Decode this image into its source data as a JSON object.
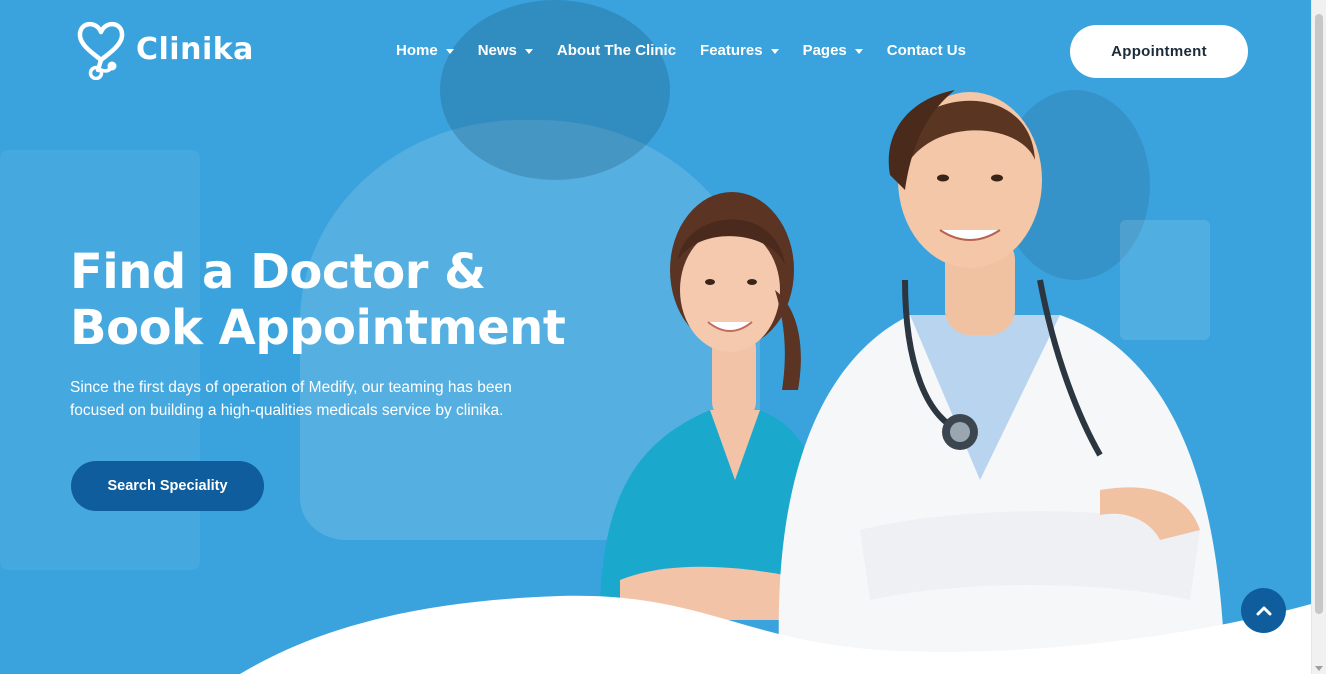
{
  "brand": {
    "name": "Clinika"
  },
  "nav": {
    "items": [
      {
        "label": "Home",
        "has_dropdown": true
      },
      {
        "label": "News",
        "has_dropdown": true
      },
      {
        "label": "About The Clinic",
        "has_dropdown": false
      },
      {
        "label": "Features",
        "has_dropdown": true
      },
      {
        "label": "Pages",
        "has_dropdown": true
      },
      {
        "label": "Contact Us",
        "has_dropdown": false
      }
    ],
    "cta_label": "Appointment"
  },
  "hero": {
    "title_line1": "Find a Doctor &",
    "title_line2": "Book Appointment",
    "description": "Since the first days of operation of Medify, our teaming has been focused on building a high-qualities medicals service by clinika.",
    "button_label": "Search Speciality"
  },
  "icons": {
    "logo": "heart-stethoscope-icon",
    "dropdown": "caret-down-icon",
    "back_to_top": "chevron-up-icon"
  },
  "colors": {
    "hero_bg": "#3aa3dd",
    "primary_dark": "#0f5d9c",
    "white": "#ffffff",
    "text_dark": "#1c2b3a"
  }
}
